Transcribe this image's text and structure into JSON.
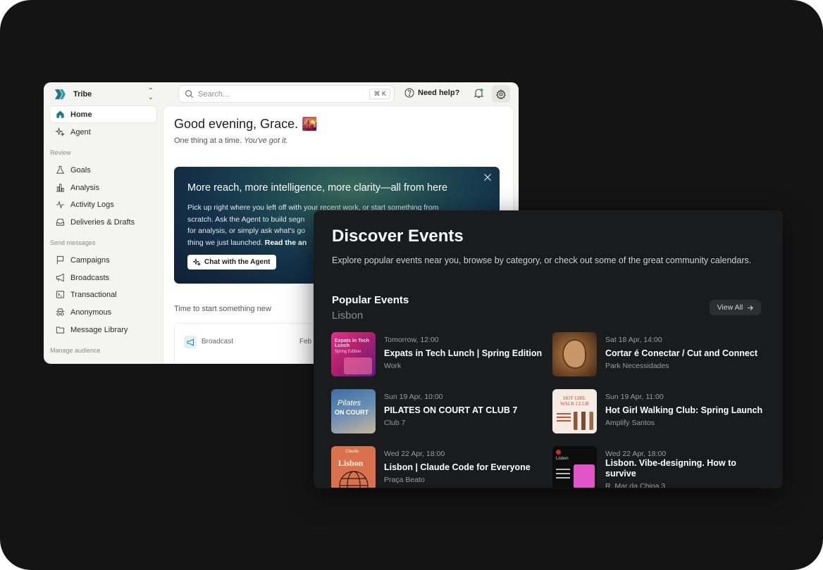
{
  "app": {
    "brand": {
      "name": "Tribe",
      "color": "#1f7a86"
    },
    "nav_top": [
      {
        "label": "Home",
        "icon": "home-icon",
        "active": true
      },
      {
        "label": "Agent",
        "icon": "sparkle-icon"
      }
    ],
    "sections": [
      {
        "title": "Review",
        "items": [
          {
            "label": "Goals",
            "icon": "flask-icon"
          },
          {
            "label": "Analysis",
            "icon": "bar-chart-icon"
          },
          {
            "label": "Activity Logs",
            "icon": "pulse-icon"
          },
          {
            "label": "Deliveries & Drafts",
            "icon": "inbox-icon"
          }
        ]
      },
      {
        "title": "Send messages",
        "items": [
          {
            "label": "Campaigns",
            "icon": "flag-icon"
          },
          {
            "label": "Broadcasts",
            "icon": "megaphone-icon"
          },
          {
            "label": "Transactional",
            "icon": "terminal-icon"
          },
          {
            "label": "Anonymous",
            "icon": "incognito-icon"
          },
          {
            "label": "Message Library",
            "icon": "folder-icon"
          }
        ]
      },
      {
        "title": "Manage audience",
        "items": []
      }
    ],
    "search": {
      "placeholder": "Search...",
      "shortcut": "⌘ K"
    },
    "help_label": "Need help?",
    "greeting": "Good evening, Grace. 🌇",
    "subgreeting_plain": "One thing at a time. ",
    "subgreeting_italic": "You've got it.",
    "promo": {
      "title": "More reach, more intelligence, more clarity—all from here",
      "body_line1": "Pick up right where you left off with your recent work, or start something from",
      "body_line2": "scratch. Ask the Agent to build segn",
      "body_line3": "for analysis, or simply ask what's go",
      "body_line4": "thing we just launched. ",
      "body_line4_bold": "Read the an",
      "button": "Chat with the Agent"
    },
    "section_label": "Time to start something new",
    "quick_card": {
      "label": "Broadcast",
      "date": "Feb"
    }
  },
  "events": {
    "title": "Discover Events",
    "subtitle": "Explore popular events near you, browse by category, or check out some of the great community calendars.",
    "popular_title": "Popular Events",
    "city": "Lisbon",
    "view_all": "View All",
    "items": [
      {
        "date": "Tomorrow, 12:00",
        "name": "Expats in Tech Lunch | Spring Edition",
        "location": "Work",
        "thumb_text": "Expats in Tech Lunch",
        "thumb_sub": "Spring Edition"
      },
      {
        "date": "Sat 18 Apr, 14:00",
        "name": "Cortar é Conectar / Cut and Connect",
        "location": "Park Necessidades"
      },
      {
        "date": "Sun 19 Apr, 10:00",
        "name": "PILATES ON COURT AT CLUB 7",
        "location": "Club 7",
        "thumb_text": "Pilates",
        "thumb_sub": "ON COURT"
      },
      {
        "date": "Sun 19 Apr, 11:00",
        "name": "Hot Girl Walking Club: Spring Launch",
        "location": "Amplify Santos",
        "thumb_text": "HOT GIRL WALK CLUB"
      },
      {
        "date": "Wed 22 Apr, 18:00",
        "name": "Lisbon | Claude Code for Everyone",
        "location": "Praça Beato",
        "thumb_text": "Lisbon",
        "thumb_sub": "Claude"
      },
      {
        "date": "Wed 22 Apr, 18:00",
        "name": "Lisbon. Vibe-designing. How to survive",
        "location": "R. Mar da China 3",
        "thumb_text": "Lisbon"
      }
    ]
  }
}
